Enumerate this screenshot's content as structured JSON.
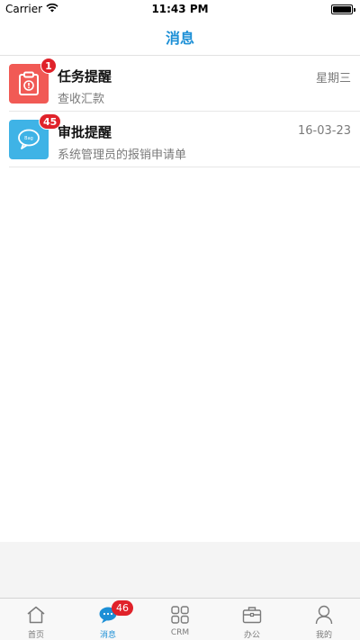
{
  "status_bar": {
    "carrier": "Carrier",
    "time": "11:43 PM",
    "wifi_icon": "wifi-icon",
    "battery_icon": "battery-icon"
  },
  "header": {
    "title": "消息"
  },
  "messages": [
    {
      "title": "任务提醒",
      "subtitle": "查收汇款",
      "time": "星期三",
      "badge": "1",
      "icon": "clipboard-icon",
      "icon_color": "#f15a55"
    },
    {
      "title": "审批提醒",
      "subtitle": "系统管理员的报销申请单",
      "time": "16-03-23",
      "badge": "45",
      "icon": "chat-bubble-icon",
      "icon_color": "#3fb3e6"
    }
  ],
  "tab_bar": {
    "active_color": "#1c8fd6",
    "items": [
      {
        "label": "首页",
        "icon": "home-icon"
      },
      {
        "label": "消息",
        "icon": "message-icon",
        "badge": "46",
        "active": true
      },
      {
        "label": "CRM",
        "icon": "grid-icon"
      },
      {
        "label": "办公",
        "icon": "briefcase-icon"
      },
      {
        "label": "我的",
        "icon": "user-icon"
      }
    ]
  }
}
